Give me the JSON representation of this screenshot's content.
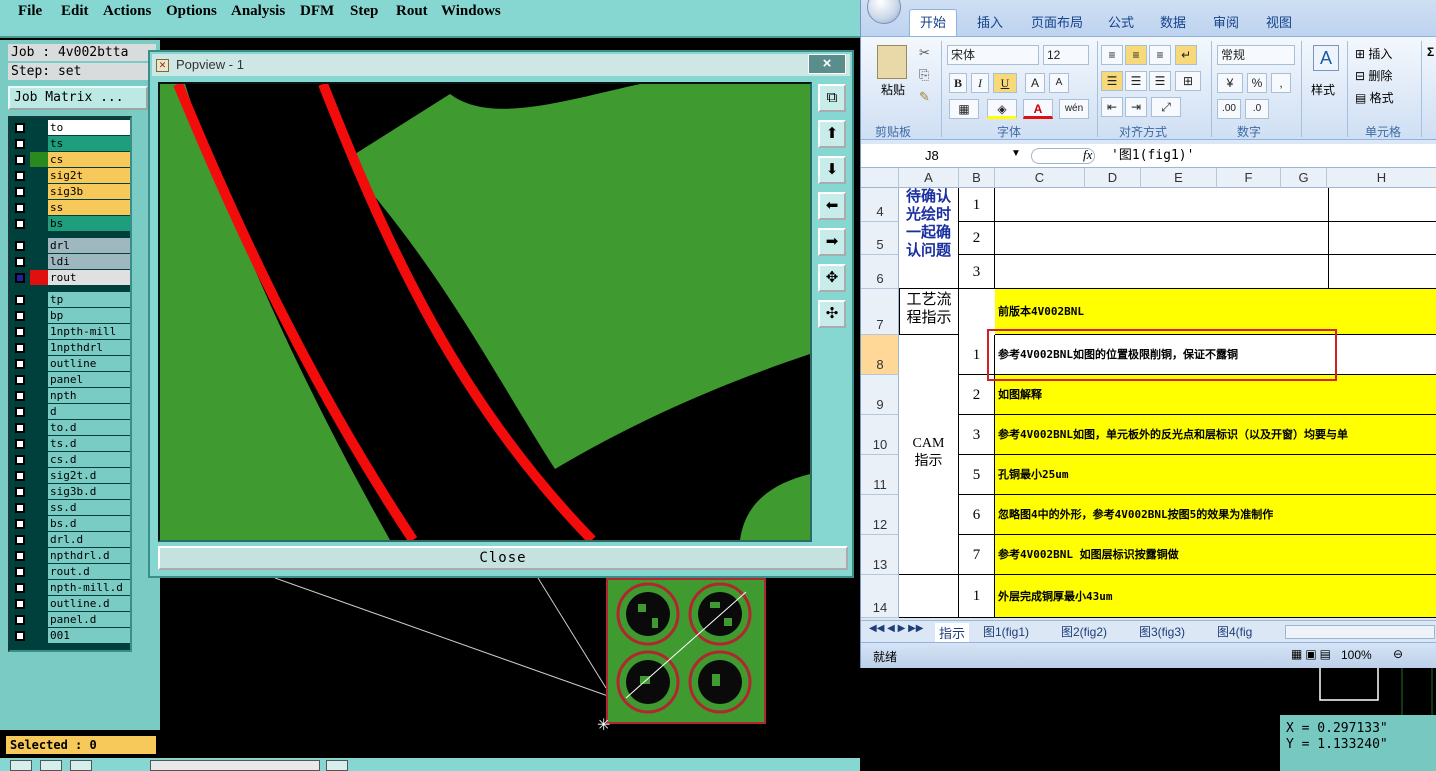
{
  "cam": {
    "menu": [
      "File",
      "Edit",
      "Actions",
      "Options",
      "Analysis",
      "DFM",
      "Step",
      "Rout",
      "Windows"
    ],
    "job_line": "Job : 4v002btta",
    "step_line": "Step: set",
    "job_matrix_label": "Job Matrix ...",
    "layers": [
      {
        "name": "to",
        "color": "#ffffff"
      },
      {
        "name": "ts",
        "color": "#1f9e7e"
      },
      {
        "name": "cs",
        "color": "#f7c85a"
      },
      {
        "name": "sig2t",
        "color": "#f7c85a"
      },
      {
        "name": "sig3b",
        "color": "#f7c85a"
      },
      {
        "name": "ss",
        "color": "#f7c85a"
      },
      {
        "name": "bs",
        "color": "#1f9e7e"
      },
      {
        "name": "drl",
        "color": "#9fb8c0"
      },
      {
        "name": "ldi",
        "color": "#9fb8c0"
      },
      {
        "name": "rout",
        "color": "#e0e0e0"
      },
      {
        "name": "tp",
        "color": "#79cbc4"
      },
      {
        "name": "bp",
        "color": "#79cbc4"
      },
      {
        "name": "1npth-mill",
        "color": "#79cbc4"
      },
      {
        "name": "1npthdrl",
        "color": "#79cbc4"
      },
      {
        "name": "outline",
        "color": "#79cbc4"
      },
      {
        "name": "panel",
        "color": "#79cbc4"
      },
      {
        "name": "npth",
        "color": "#79cbc4"
      },
      {
        "name": "d",
        "color": "#79cbc4"
      },
      {
        "name": "to.d",
        "color": "#79cbc4"
      },
      {
        "name": "ts.d",
        "color": "#79cbc4"
      },
      {
        "name": "cs.d",
        "color": "#79cbc4"
      },
      {
        "name": "sig2t.d",
        "color": "#79cbc4"
      },
      {
        "name": "sig3b.d",
        "color": "#79cbc4"
      },
      {
        "name": "ss.d",
        "color": "#79cbc4"
      },
      {
        "name": "bs.d",
        "color": "#79cbc4"
      },
      {
        "name": "drl.d",
        "color": "#79cbc4"
      },
      {
        "name": "npthdrl.d",
        "color": "#79cbc4"
      },
      {
        "name": "rout.d",
        "color": "#79cbc4"
      },
      {
        "name": "npth-mill.d",
        "color": "#79cbc4"
      },
      {
        "name": "outline.d",
        "color": "#79cbc4"
      },
      {
        "name": "panel.d",
        "color": "#79cbc4"
      },
      {
        "name": "001",
        "color": "#79cbc4"
      }
    ],
    "selected_text": "Selected : 0",
    "coords": {
      "x": "X = 0.297133\"",
      "y": "Y = 1.133240\""
    }
  },
  "popview": {
    "title": "Popview - 1",
    "close_label": "Close",
    "close_x": "×"
  },
  "excel": {
    "tabs": [
      "开始",
      "插入",
      "页面布局",
      "公式",
      "数据",
      "审阅",
      "视图"
    ],
    "paste_label": "粘贴",
    "font_name": "宋体",
    "font_size": "12",
    "number_format": "常规",
    "style_label": "样式",
    "insert_label": "插入",
    "delete_label": "删除",
    "format_label": "格式",
    "group_labels": [
      "剪贴板",
      "字体",
      "对齐方式",
      "数字",
      "单元格"
    ],
    "name_box": "J8",
    "formula": "'图1(fig1)'",
    "columns": [
      "A",
      "B",
      "C",
      "D",
      "E",
      "F",
      "G",
      "H"
    ],
    "row_numbers": [
      "4",
      "5",
      "6",
      "7",
      "8",
      "9",
      "10",
      "11",
      "12",
      "13",
      "14"
    ],
    "merged_a1": "待确认光绘时一起确认问题",
    "merged_a2": "工艺流程指示",
    "merged_a3": "CAM指示",
    "seq": [
      "1",
      "2",
      "3",
      "1",
      "2",
      "3",
      "5",
      "6",
      "7",
      "1"
    ],
    "row7_text": "前版本4V002BNL",
    "cam_rows": [
      "参考4V002BNL如图的位置极限削铜，保证不露铜",
      "如图解释",
      "参考4V002BNL如图，单元板外的反光点和层标识（以及开窗）均要与单",
      "孔铜最小25um",
      "忽略图4中的外形，参考4V002BNL按图5的效果为准制作",
      "参考4V002BNL  如图层标识按露铜做"
    ],
    "row14_text": "外层完成铜厚最小43um",
    "sheet_tabs": [
      "指示",
      "图1(fig1)",
      "图2(fig2)",
      "图3(fig3)",
      "图4(fig"
    ],
    "status": "就绪",
    "zoom": "100%"
  }
}
